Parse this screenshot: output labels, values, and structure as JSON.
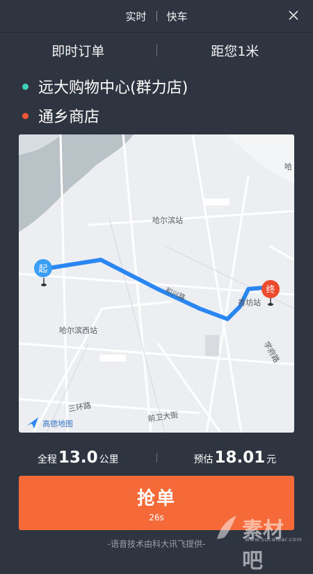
{
  "header": {
    "tab_realtime": "实时",
    "tab_express": "快车",
    "close_icon": "close-icon"
  },
  "order": {
    "type_label": "即时订单",
    "distance_label": "距您1米"
  },
  "route": {
    "start": "远大购物中心(群力店)",
    "end": "通乡商店",
    "start_color": "#3fd0b8",
    "end_color": "#f2543a"
  },
  "map": {
    "start_marker": "起",
    "end_marker": "终",
    "label_harbin_station": "哈尔滨站",
    "label_harbin_west": "哈尔滨西站",
    "label_xiangfang": "香坊站",
    "label_sanhuan": "三环路",
    "label_qianwei": "前卫大街",
    "label_road_mid": "和兴路",
    "label_road_right": "学府路",
    "label_edge": "哈",
    "logo_text": "高德地图",
    "route_color": "#2a86f0"
  },
  "summary": {
    "total_prefix": "全程",
    "total_value": "13.0",
    "total_unit": "公里",
    "estimate_prefix": "预估",
    "estimate_value": "18.01",
    "estimate_unit": "元"
  },
  "grab_button": {
    "label": "抢单",
    "countdown": "26s",
    "color": "#f66a3a"
  },
  "footer": {
    "text": "-语音技术由科大讯飞提供-"
  },
  "watermark": {
    "text": "素材吧",
    "url": "www.sucaibar.com"
  }
}
